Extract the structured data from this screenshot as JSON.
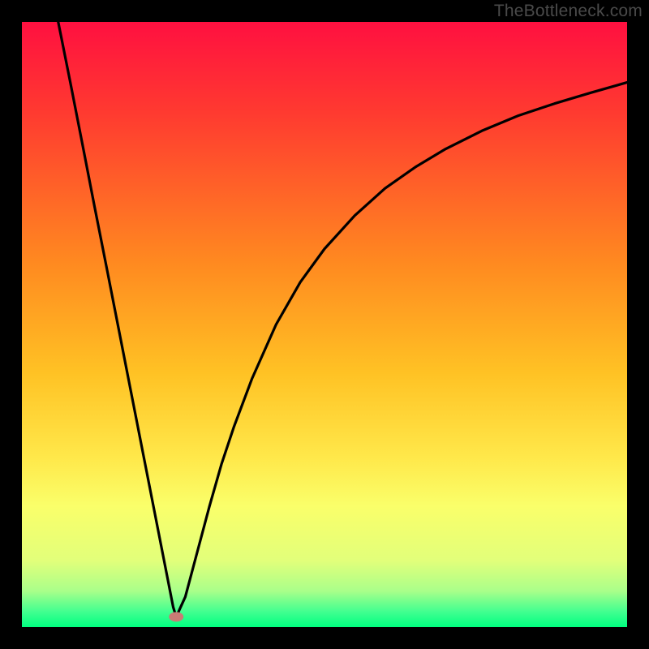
{
  "attribution": "TheBottleneck.com",
  "chart_data": {
    "type": "line",
    "title": "",
    "xlabel": "",
    "ylabel": "",
    "xlim": [
      0,
      100
    ],
    "ylim": [
      0,
      100
    ],
    "background": {
      "type": "vertical-gradient",
      "stops": [
        {
          "offset": 0.0,
          "color": "#ff1040"
        },
        {
          "offset": 0.15,
          "color": "#ff3a30"
        },
        {
          "offset": 0.4,
          "color": "#ff8a20"
        },
        {
          "offset": 0.58,
          "color": "#ffc224"
        },
        {
          "offset": 0.72,
          "color": "#ffe84a"
        },
        {
          "offset": 0.8,
          "color": "#faff6a"
        },
        {
          "offset": 0.89,
          "color": "#e2ff7a"
        },
        {
          "offset": 0.94,
          "color": "#aaff8a"
        },
        {
          "offset": 0.975,
          "color": "#40ff90"
        },
        {
          "offset": 1.0,
          "color": "#00ff80"
        }
      ]
    },
    "marker": {
      "x": 25.5,
      "y": 1.7,
      "color": "#c97b75"
    },
    "series": [
      {
        "name": "left-branch",
        "x": [
          6.0,
          8.0,
          10.0,
          12.0,
          14.0,
          16.0,
          18.0,
          20.0,
          22.0,
          23.0,
          24.0,
          25.0,
          25.5
        ],
        "y": [
          100.0,
          90.0,
          79.8,
          69.5,
          59.4,
          49.2,
          39.0,
          28.8,
          18.6,
          13.5,
          8.4,
          3.3,
          1.7
        ]
      },
      {
        "name": "right-branch",
        "x": [
          25.5,
          27.0,
          29.0,
          31.0,
          33.0,
          35.0,
          38.0,
          42.0,
          46.0,
          50.0,
          55.0,
          60.0,
          65.0,
          70.0,
          76.0,
          82.0,
          88.0,
          94.0,
          100.0
        ],
        "y": [
          1.7,
          5.0,
          12.5,
          20.0,
          27.0,
          33.0,
          41.0,
          50.0,
          57.0,
          62.5,
          68.0,
          72.5,
          76.0,
          79.0,
          82.0,
          84.5,
          86.5,
          88.3,
          90.0
        ]
      }
    ]
  }
}
